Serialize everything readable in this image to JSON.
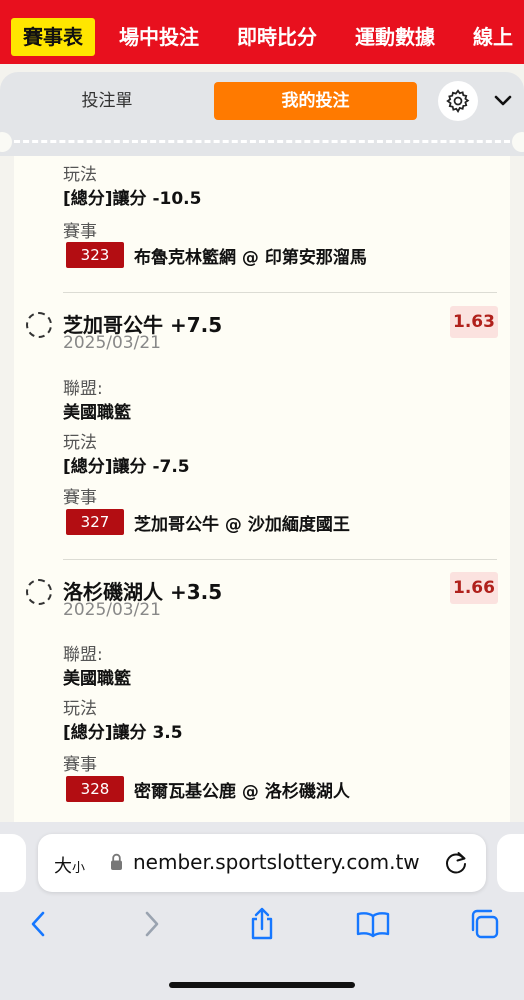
{
  "nav": {
    "items": [
      "賽事表",
      "場中投注",
      "即時比分",
      "運動數據",
      "線上"
    ]
  },
  "tabs": {
    "slip": "投注單",
    "my_bets": "我的投注"
  },
  "icons": {
    "settings": "gear-icon",
    "collapse": "chevron-down-icon"
  },
  "labels": {
    "league": "聯盟:",
    "bet_type": "玩法",
    "match": "賽事"
  },
  "bets": [
    {
      "bet_type": "[總分]讓分 -10.5",
      "match_no": "323",
      "match": "布魯克林籃網 @ 印第安那溜馬"
    },
    {
      "selection": "芝加哥公牛 +7.5",
      "date": "2025/03/21",
      "odds": "1.63",
      "league": "美國職籃",
      "bet_type": "[總分]讓分 -7.5",
      "match_no": "327",
      "match": "芝加哥公牛 @ 沙加緬度國王"
    },
    {
      "selection": "洛杉磯湖人 +3.5",
      "date": "2025/03/21",
      "odds": "1.66",
      "league": "美國職籃",
      "bet_type": "[總分]讓分 3.5",
      "match_no": "328",
      "match": "密爾瓦基公鹿 @ 洛杉磯湖人"
    }
  ],
  "browser": {
    "text_size": "大",
    "text_size_small": "小",
    "url": "nember.sportslottery.com.tw"
  },
  "colors": {
    "brand_red": "#e8101e",
    "nav_active": "#ffe600",
    "tab_active": "#ff7a00",
    "badge": "#b30d12",
    "odds_text": "#b0201b"
  }
}
